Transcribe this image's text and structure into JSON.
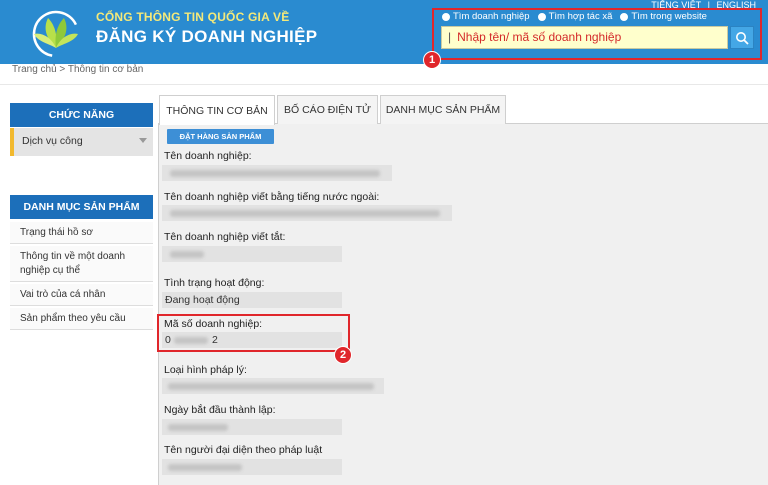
{
  "header": {
    "title_top": "CỔNG THÔNG TIN QUỐC GIA VỀ",
    "title_main": "ĐĂNG KÝ DOANH NGHIỆP",
    "lang_vi": "TIẾNG VIỆT",
    "lang_sep": "|",
    "lang_en": "ENGLISH",
    "search": {
      "options": [
        "Tìm doanh nghiệp",
        "Tìm hợp tác xã",
        "Tìm trong website"
      ],
      "placeholder": "Nhập tên/ mã số doanh nghiệp"
    },
    "badge1": "1"
  },
  "breadcrumb": "Trang chủ > Thông tin cơ bản",
  "sidebar": {
    "functions_title": "CHỨC NĂNG",
    "public_service": "Dịch vụ công",
    "catalog_title": "DANH MỤC SẢN PHẨM",
    "items": [
      "Trạng thái hồ sơ",
      "Thông tin về một doanh nghiệp cụ thể",
      "Vai trò của cá nhân",
      "Sản phẩm theo yêu cầu"
    ]
  },
  "tabs": [
    "THÔNG TIN CƠ BẢN",
    "BỐ CÁO ĐIỆN TỬ",
    "DANH MỤC SẢN PHẨM"
  ],
  "order_button": "ĐẶT HÀNG SẢN PHẨM",
  "fields": {
    "name": "Tên doanh nghiệp:",
    "foreign_name": "Tên doanh nghiệp viết bằng tiếng nước ngoài:",
    "short_name": "Tên doanh nghiệp viết tắt:",
    "status_label": "Tình trạng hoạt động:",
    "status_value": "Đang hoạt động",
    "tax_label": "Mã số doanh nghiệp:",
    "tax_prefix": "0",
    "tax_suffix": "2",
    "legal_type": "Loại hình pháp lý:",
    "start_date": "Ngày bắt đầu thành lập:",
    "representative": "Tên người đại diện theo pháp luật"
  },
  "badge2": "2"
}
